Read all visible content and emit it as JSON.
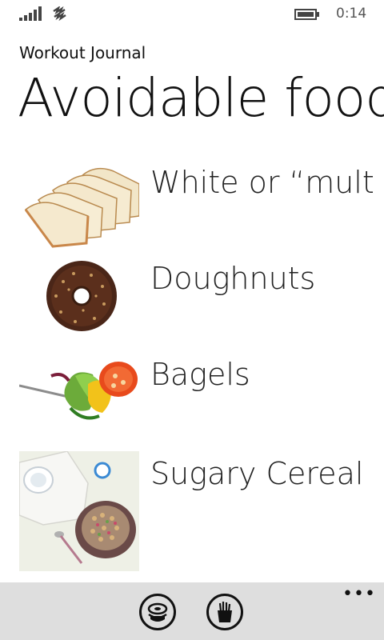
{
  "status_bar": {
    "time": "0:14",
    "signal_icon": "signal-bars-icon",
    "wifi_icon": "wifi-icon",
    "battery_icon": "battery-icon"
  },
  "header": {
    "app_title": "Workout Journal",
    "page_title": "Avoidable food"
  },
  "foods": [
    {
      "name": "White or “mult",
      "image": "sliced-bread-image"
    },
    {
      "name": "Doughnuts",
      "image": "chocolate-doughnut-image"
    },
    {
      "name": "Bagels",
      "image": "salad-fork-image"
    },
    {
      "name": "Sugary Cereal",
      "image": "cereal-milk-image"
    }
  ],
  "app_bar": {
    "buttons": [
      {
        "icon": "sushi-icon"
      },
      {
        "icon": "fries-icon"
      }
    ],
    "more_label": "•••"
  },
  "colors": {
    "background": "#ffffff",
    "app_bar": "#dedede",
    "text": "#111111"
  }
}
